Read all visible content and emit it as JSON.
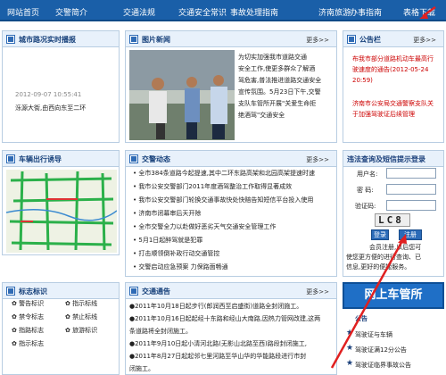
{
  "nav": [
    "网站首页",
    "交警简介",
    "交通法规",
    "交通安全常识",
    "事故处理指南",
    "济南旅游",
    "办事指南",
    "表格下载"
  ],
  "left": {
    "realtime": {
      "title": "城市路况实时播报",
      "time": "2012-09-07 10:55:41",
      "text": "泺源大街,由西向东至二环"
    },
    "query": {
      "title": "车辆出行诱导"
    },
    "signs": {
      "title": "标志标识",
      "items": [
        "警告标识",
        "指示标线",
        "禁令标志",
        "禁止标线",
        "指路标志",
        "旅游标识",
        "指示标志"
      ]
    }
  },
  "mid": {
    "pic": {
      "title": "图片新闻",
      "more": "更多>>",
      "text": [
        "为切实加强我市道路交通",
        "安全工作,使更多群众了解酒",
        "驾危害,普法推进道路交通安全",
        "宣传氛围。5月23日下午,交警",
        "支队车管所开展\"关爱生命拒",
        "绝酒驾\"交通安全"
      ]
    },
    "news": {
      "title": "交警动态",
      "more": "更多>>",
      "items": [
        "全市384条道路今起提速,其中二环东路高架和北园高架提速时速",
        "我市公安交警部门2011年度酒驾整治工作取得显著成效",
        "我市公安交警部门轮换交通事故快处快赔告知短信平台投入使用",
        "济南市闭幕审后天开除",
        "全市交警全力以赴做好恶劣天气交通安全管理工作",
        "5月1日起醉驾就是犯罪",
        "打击顺领倒补政行动交通管控",
        "交警启动应急预案 力保路面畅通"
      ]
    },
    "notice": {
      "title": "交通通告",
      "more": "更多>>",
      "items": [
        "●2011年10月18日起步行(郎润西至启盛街)道路全封闭施工。",
        "●2011年10月16日起起经十东路和经山大南路,因热力管网改建,这两",
        "条道路将全封闭施工。",
        "●2011年9月10日起小清河北路(无影山北路至西)路段封闭施工,",
        "●2011年8月27日起起邻七里河路至华山华的华能路段进行市封",
        "闭施工。"
      ]
    }
  },
  "right": {
    "bulletin": {
      "title": "公告栏",
      "more": "更多>>",
      "items": [
        {
          "text": "布我市部分道路机动车最高行驶速度的通告",
          "date": "(2012-05-24 20:59)"
        },
        {
          "text": "济南市公安局交通警察支队关于加强驾驶证后续管理",
          "date": ""
        }
      ]
    },
    "login": {
      "title": "违法查询及短信提示登录",
      "user_label": "用户名:",
      "pwd_label": "密 码:",
      "captcha_label": "验证码:",
      "captcha": "LC8",
      "login_btn": "登录",
      "register_btn": "注册",
      "note": [
        "会员注册,以后您可",
        "使您更方便的进行查询、已",
        "信息,更好的便捷服务。"
      ]
    },
    "banner": "网上车管所",
    "links": [
      "驾驶证与车辆",
      "驾驶证满12分公告",
      "驾驶证临界事故公告"
    ],
    "links_title": "公告"
  }
}
